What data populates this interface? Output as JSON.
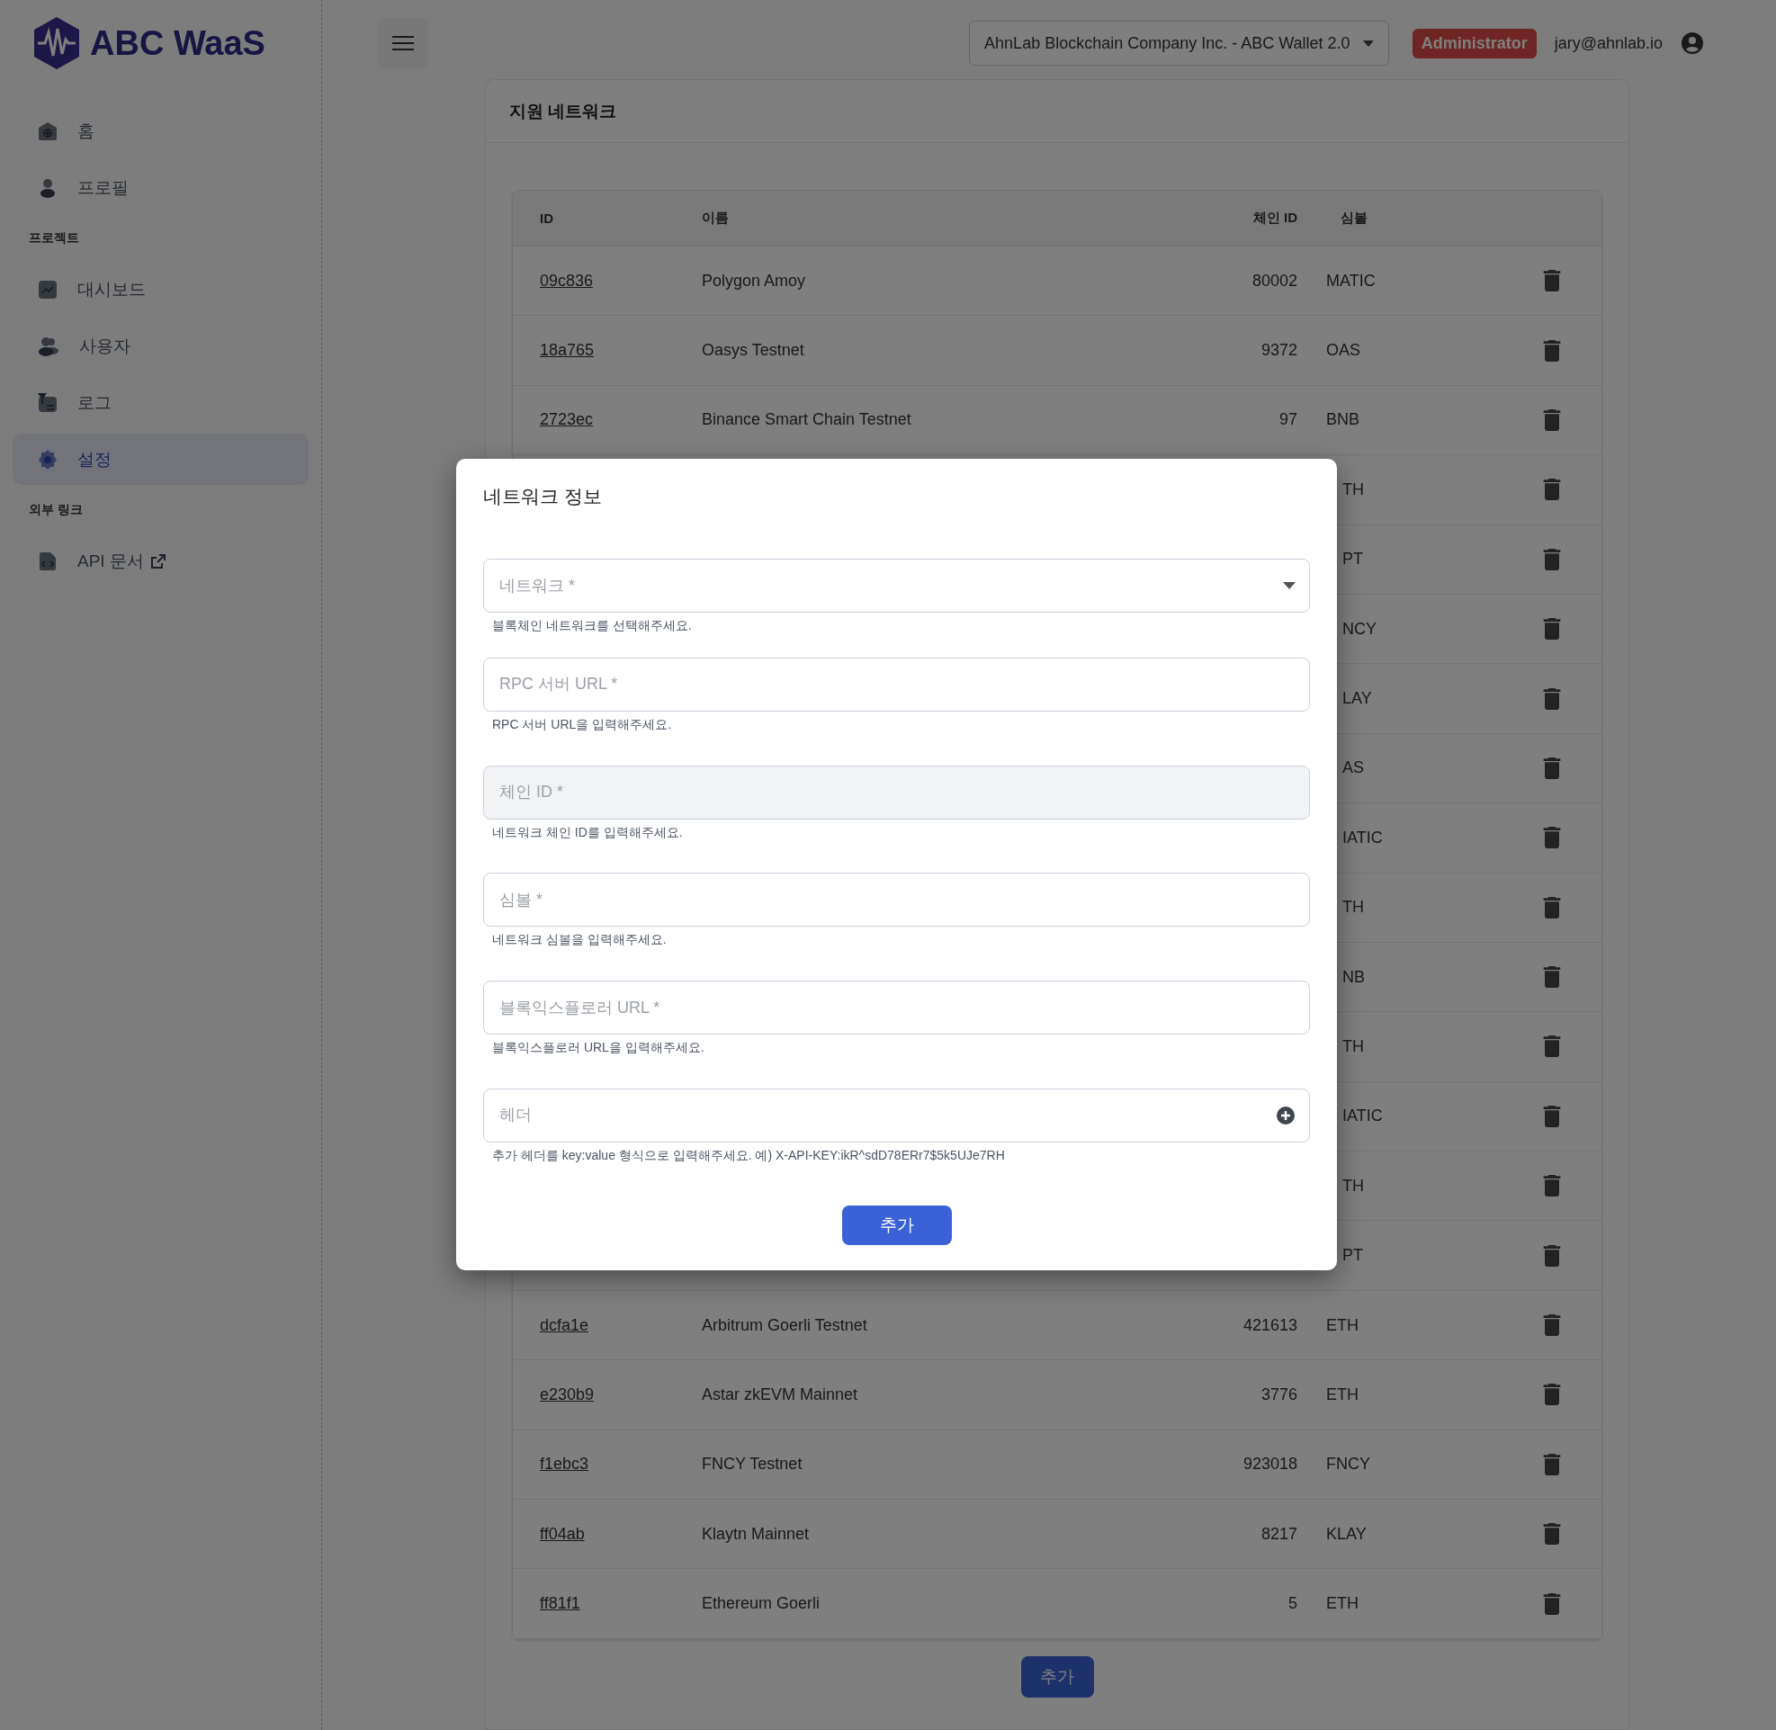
{
  "logo": {
    "text": "ABC WaaS"
  },
  "sidebar": [
    {
      "kind": "item",
      "label": "홈",
      "selected": false,
      "external": false
    },
    {
      "kind": "item",
      "label": "프로필",
      "selected": false,
      "external": false
    },
    {
      "kind": "section",
      "label": "프로젝트"
    },
    {
      "kind": "item",
      "label": "대시보드",
      "selected": false,
      "external": false
    },
    {
      "kind": "item",
      "label": "사용자",
      "selected": false,
      "external": false
    },
    {
      "kind": "item",
      "label": "로그",
      "selected": false,
      "external": false
    },
    {
      "kind": "item",
      "label": "설정",
      "selected": true,
      "external": false
    },
    {
      "kind": "section",
      "label": "외부 링크"
    },
    {
      "kind": "item",
      "label": "API 문서",
      "selected": false,
      "external": true
    }
  ],
  "header": {
    "workspace": "AhnLab Blockchain Company Inc. - ABC Wallet 2.0",
    "role": "Administrator",
    "email": "jary@ahnlab.io"
  },
  "card": {
    "title": "지원 네트워크",
    "add_button": "추가"
  },
  "table": {
    "columns": [
      "ID",
      "이름",
      "체인 ID",
      "심볼"
    ],
    "rows": [
      {
        "kind": "full",
        "id": "09c836",
        "name": "Polygon Amoy",
        "chain_id": "80002",
        "symbol": "MATIC"
      },
      {
        "kind": "full",
        "id": "18a765",
        "name": "Oasys Testnet",
        "chain_id": "9372",
        "symbol": "OAS"
      },
      {
        "kind": "full",
        "id": "2723ec",
        "name": "Binance Smart Chain Testnet",
        "chain_id": "97",
        "symbol": "BNB"
      },
      {
        "kind": "covered",
        "symbol": "TH"
      },
      {
        "kind": "covered",
        "symbol": "PT"
      },
      {
        "kind": "covered",
        "symbol": "NCY"
      },
      {
        "kind": "covered",
        "symbol": "LAY"
      },
      {
        "kind": "covered",
        "symbol": "AS"
      },
      {
        "kind": "covered",
        "symbol": "IATIC"
      },
      {
        "kind": "covered",
        "symbol": "TH"
      },
      {
        "kind": "covered",
        "symbol": "NB"
      },
      {
        "kind": "covered",
        "symbol": "TH"
      },
      {
        "kind": "covered",
        "symbol": "IATIC"
      },
      {
        "kind": "covered",
        "symbol": "TH"
      },
      {
        "kind": "covered",
        "symbol": "PT"
      },
      {
        "kind": "full",
        "id": "dcfa1e",
        "name": "Arbitrum Goerli Testnet",
        "chain_id": "421613",
        "symbol": "ETH"
      },
      {
        "kind": "full",
        "id": "e230b9",
        "name": "Astar zkEVM Mainnet",
        "chain_id": "3776",
        "symbol": "ETH"
      },
      {
        "kind": "full",
        "id": "f1ebc3",
        "name": "FNCY Testnet",
        "chain_id": "923018",
        "symbol": "FNCY"
      },
      {
        "kind": "full",
        "id": "ff04ab",
        "name": "Klaytn Mainnet",
        "chain_id": "8217",
        "symbol": "KLAY"
      },
      {
        "kind": "full",
        "id": "ff81f1",
        "name": "Ethereum Goerli",
        "chain_id": "5",
        "symbol": "ETH"
      }
    ]
  },
  "modal": {
    "title": "네트워크 정보",
    "fields": [
      {
        "kind": "select",
        "placeholder": "네트워크 *",
        "helper": "블록체인 네트워크를 선택해주세요.",
        "disabled": false
      },
      {
        "kind": "text",
        "placeholder": "RPC 서버 URL *",
        "helper": "RPC 서버 URL을 입력해주세요.",
        "disabled": false
      },
      {
        "kind": "text",
        "placeholder": "체인 ID *",
        "helper": "네트워크 체인 ID를 입력해주세요.",
        "disabled": true
      },
      {
        "kind": "text",
        "placeholder": "심볼 *",
        "helper": "네트워크 심볼을 입력해주세요.",
        "disabled": false
      },
      {
        "kind": "text",
        "placeholder": "블록익스플로러 URL *",
        "helper": "블록익스플로러 URL을 입력해주세요.",
        "disabled": false
      },
      {
        "kind": "header",
        "placeholder": "헤더",
        "helper": "추가 헤더를 key:value 형식으로 입력해주세요. 예) X-API-KEY:ikR^sdD78ERr7$5k5UJe7RH",
        "disabled": false
      }
    ],
    "submit": "추가"
  }
}
